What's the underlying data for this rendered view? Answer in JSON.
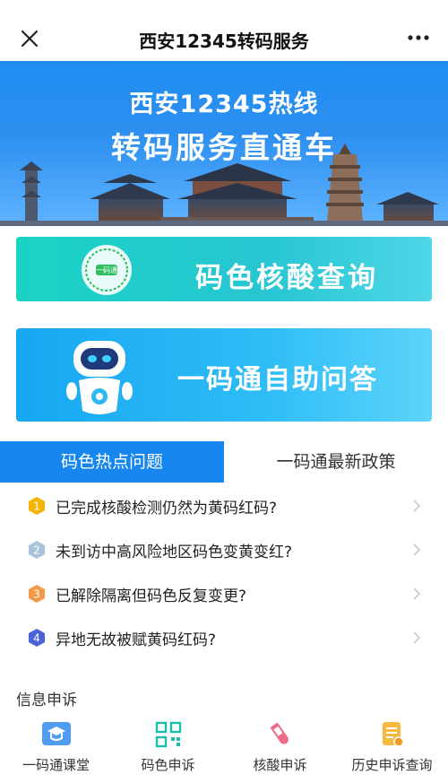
{
  "navbar": {
    "title": "西安12345转码服务",
    "close_icon": "close-icon",
    "more_icon": "more-dots-icon"
  },
  "banner": {
    "line1": "西安12345热线",
    "line2": "转码服务直通车",
    "colors": {
      "sky_top": "#1f8ef1",
      "sky_bottom": "#5fb4ff"
    }
  },
  "cards": {
    "nucleic": {
      "label": "码色核酸查询",
      "icon": "qr-code-badge-icon"
    },
    "selfhelp": {
      "label": "一码通自助问答",
      "icon": "robot-icon"
    }
  },
  "tabs": [
    {
      "label": "码色热点问题",
      "active": true
    },
    {
      "label": "一码通最新政策",
      "active": false
    }
  ],
  "faq": [
    {
      "num": "1",
      "text": "已完成核酸检测仍然为黄码红码?",
      "color": "#f5b400"
    },
    {
      "num": "2",
      "text": "未到访中高风险地区码色变黄变红?",
      "color": "#a9c3da"
    },
    {
      "num": "3",
      "text": "已解除隔离但码色反复变更?",
      "color": "#f39a4a"
    },
    {
      "num": "4",
      "text": "异地无故被赋黄码红码?",
      "color": "#4a63d8"
    }
  ],
  "appeal": {
    "title": "信息申诉",
    "items": [
      {
        "label": "一码通课堂",
        "icon": "classroom-icon"
      },
      {
        "label": "码色申诉",
        "icon": "qr-code-icon"
      },
      {
        "label": "核酸申诉",
        "icon": "test-tube-icon"
      },
      {
        "label": "历史申诉查询",
        "icon": "history-document-icon"
      }
    ]
  },
  "colors": {
    "accent": "#1787ef",
    "card_teal": "#1ad3c3",
    "card_blue": "#16a7f1"
  }
}
